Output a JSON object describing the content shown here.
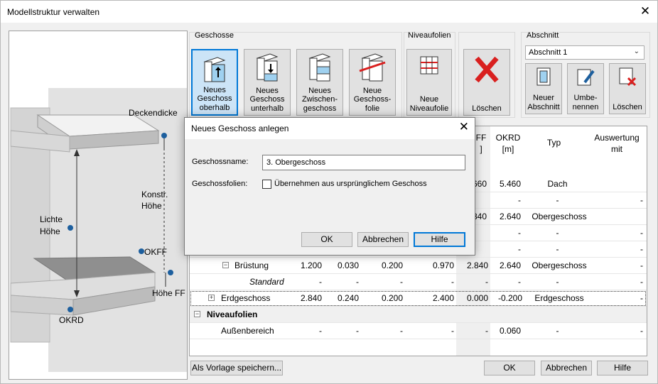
{
  "window": {
    "title": "Modellstruktur verwalten",
    "close": "✕"
  },
  "illustration": {
    "deckendicke": "Deckendicke",
    "konstr_hoehe": [
      "Konstr.",
      "Höhe"
    ],
    "lichte_hoehe": [
      "Lichte",
      "Höhe"
    ],
    "okff": "OKFF",
    "hoehe_ff": "Höhe FF",
    "okrd": "OKRD"
  },
  "ribbon": {
    "geschosse_label": "Geschosse",
    "niveau_label": "Niveaufolien",
    "abschnitt_label": "Abschnitt",
    "buttons": {
      "neues_oberhalb": [
        "Neues",
        "Geschoss",
        "oberhalb"
      ],
      "neues_unterhalb": [
        "Neues",
        "Geschoss",
        "unterhalb"
      ],
      "neues_zwischen": [
        "Neues",
        "Zwischen-",
        "geschoss"
      ],
      "neue_folie": [
        "Neue",
        "Geschoss-",
        "folie"
      ],
      "neue_niveau": [
        "Neue",
        "Niveaufolie"
      ],
      "loeschen": "Löschen",
      "neuer_abschnitt": [
        "Neuer",
        "Abschnitt"
      ],
      "umbenennen": [
        "Umbe-",
        "nennen"
      ],
      "abschnitt_loeschen": "Löschen"
    },
    "abschnitt_select": "Abschnitt 1"
  },
  "table": {
    "headers": {
      "ff": "FF",
      "ff_unit": "]",
      "okrd": "OKRD",
      "okrd_unit": "[m]",
      "typ": "Typ",
      "auswertung": "Auswertung",
      "auswertung2": "mit"
    },
    "rows": [
      {
        "c4": "660",
        "c5": "5.460",
        "typ": "Dach",
        "last": ""
      },
      {
        "c4": "",
        "c5": "-",
        "typ": "-",
        "last": "-"
      },
      {
        "c4": "840",
        "c5": "2.640",
        "typ": "Obergeschoss",
        "last": ""
      },
      {
        "c4": "",
        "c5": "-",
        "typ": "-",
        "last": "-"
      },
      {
        "c4": "",
        "c5": "-",
        "typ": "-",
        "last": "-"
      },
      {
        "name": "Brüstung",
        "a": "1.200",
        "b": "0.030",
        "c": "0.200",
        "d": "0.970",
        "e": "2.840",
        "f": "2.640",
        "typ": "Obergeschoss",
        "last": "-"
      },
      {
        "name": "Standard",
        "a": "-",
        "b": "-",
        "c": "-",
        "d": "-",
        "e": "-",
        "f": "-",
        "typ": "-",
        "last": "-"
      },
      {
        "name": "Erdgeschoss",
        "a": "2.840",
        "b": "0.240",
        "c": "0.200",
        "d": "2.400",
        "e": "0.000",
        "f": "-0.200",
        "typ": "Erdgeschoss",
        "last": "-"
      },
      {
        "name": "Niveaufolien"
      },
      {
        "name": "Außenbereich",
        "a": "-",
        "b": "-",
        "c": "-",
        "d": "-",
        "e": "-",
        "f": "0.060",
        "typ": "-",
        "last": "-"
      }
    ]
  },
  "footer": {
    "save_template": "Als Vorlage speichern...",
    "ok": "OK",
    "cancel": "Abbrechen",
    "help": "Hilfe"
  },
  "dialog": {
    "title": "Neues Geschoss anlegen",
    "close": "✕",
    "name_label": "Geschossname:",
    "name_value": "3. Obergeschoss",
    "folien_label": "Geschossfolien:",
    "folien_checkbox": "Übernehmen aus ursprünglichem Geschoss",
    "ok": "OK",
    "cancel": "Abbrechen",
    "help": "Hilfe"
  },
  "colors": {
    "accent": "#0078d7",
    "delete_red": "#d9201f",
    "marker": "#1d5f9e"
  }
}
